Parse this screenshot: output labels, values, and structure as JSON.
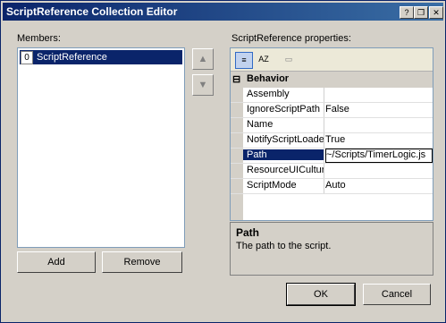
{
  "window": {
    "title": "ScriptReference Collection Editor"
  },
  "titlebar_buttons": {
    "help": "?",
    "restore": "❐",
    "close": "✕"
  },
  "members": {
    "label": "Members:",
    "items": [
      {
        "index": "0",
        "label": "ScriptReference"
      }
    ]
  },
  "arrows": {
    "up": "▲",
    "down": "▼"
  },
  "buttons": {
    "add": "Add",
    "remove": "Remove",
    "ok": "OK",
    "cancel": "Cancel"
  },
  "properties": {
    "label": "ScriptReference properties:",
    "toolbar": {
      "categorized": "≡",
      "alphabetical": "AZ",
      "pages": "▭"
    },
    "category": {
      "toggle": "⊟",
      "name": "Behavior"
    },
    "rows": [
      {
        "name": "Assembly",
        "value": ""
      },
      {
        "name": "IgnoreScriptPath",
        "value": "False"
      },
      {
        "name": "Name",
        "value": ""
      },
      {
        "name": "NotifyScriptLoaded",
        "value": "True"
      },
      {
        "name": "Path",
        "value": "~/Scripts/TimerLogic.js"
      },
      {
        "name": "ResourceUICultures",
        "value": ""
      },
      {
        "name": "ScriptMode",
        "value": "Auto"
      }
    ],
    "selected_index": 4
  },
  "description": {
    "title": "Path",
    "text": "The path to the script."
  }
}
